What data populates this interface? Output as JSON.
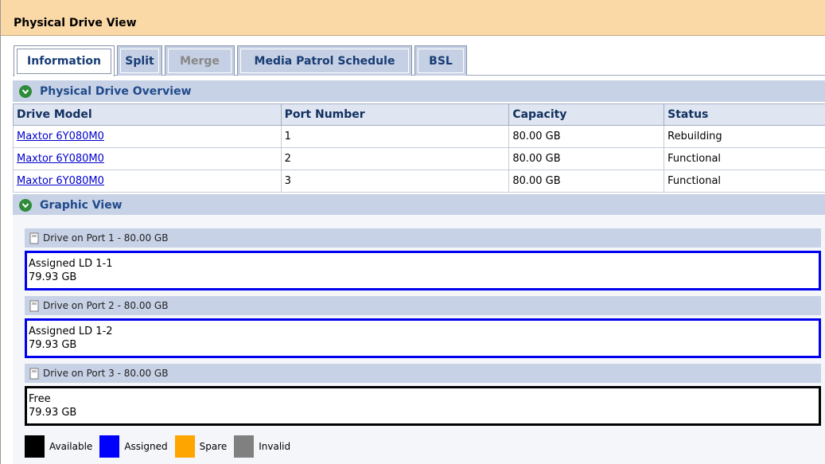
{
  "window": {
    "title": "Physical Drive View"
  },
  "tabs": [
    {
      "label": "Information",
      "state": "active"
    },
    {
      "label": "Split",
      "state": "normal"
    },
    {
      "label": "Merge",
      "state": "disabled"
    },
    {
      "label": "Media Patrol Schedule",
      "state": "normal"
    },
    {
      "label": "BSL",
      "state": "normal"
    }
  ],
  "overview": {
    "title": "Physical Drive Overview",
    "columns": [
      "Drive Model",
      "Port Number",
      "Capacity",
      "Status"
    ],
    "rows": [
      {
        "model": "Maxtor 6Y080M0",
        "port": "1",
        "capacity": "80.00 GB",
        "status": "Rebuilding"
      },
      {
        "model": "Maxtor 6Y080M0",
        "port": "2",
        "capacity": "80.00 GB",
        "status": "Functional"
      },
      {
        "model": "Maxtor 6Y080M0",
        "port": "3",
        "capacity": "80.00 GB",
        "status": "Functional"
      }
    ]
  },
  "graphic": {
    "title": "Graphic View",
    "drives": [
      {
        "header": "Drive on Port 1 - 80.00 GB",
        "name": "Assigned LD 1-1",
        "size": "79.93 GB",
        "kind": "assigned"
      },
      {
        "header": "Drive on Port 2 - 80.00 GB",
        "name": "Assigned LD 1-2",
        "size": "79.93 GB",
        "kind": "assigned"
      },
      {
        "header": "Drive on Port 3 - 80.00 GB",
        "name": "Free",
        "size": "79.93 GB",
        "kind": "available"
      }
    ]
  },
  "legend": [
    {
      "label": "Available",
      "color": "#000000"
    },
    {
      "label": "Assigned",
      "color": "#0000ff"
    },
    {
      "label": "Spare",
      "color": "#ffa500"
    },
    {
      "label": "Invalid",
      "color": "#808080"
    }
  ],
  "colors": {
    "title_bar": "#fbd9a7",
    "section_header": "#c8d2e6",
    "link": "#0000cc",
    "assigned_border": "#0000ee"
  }
}
